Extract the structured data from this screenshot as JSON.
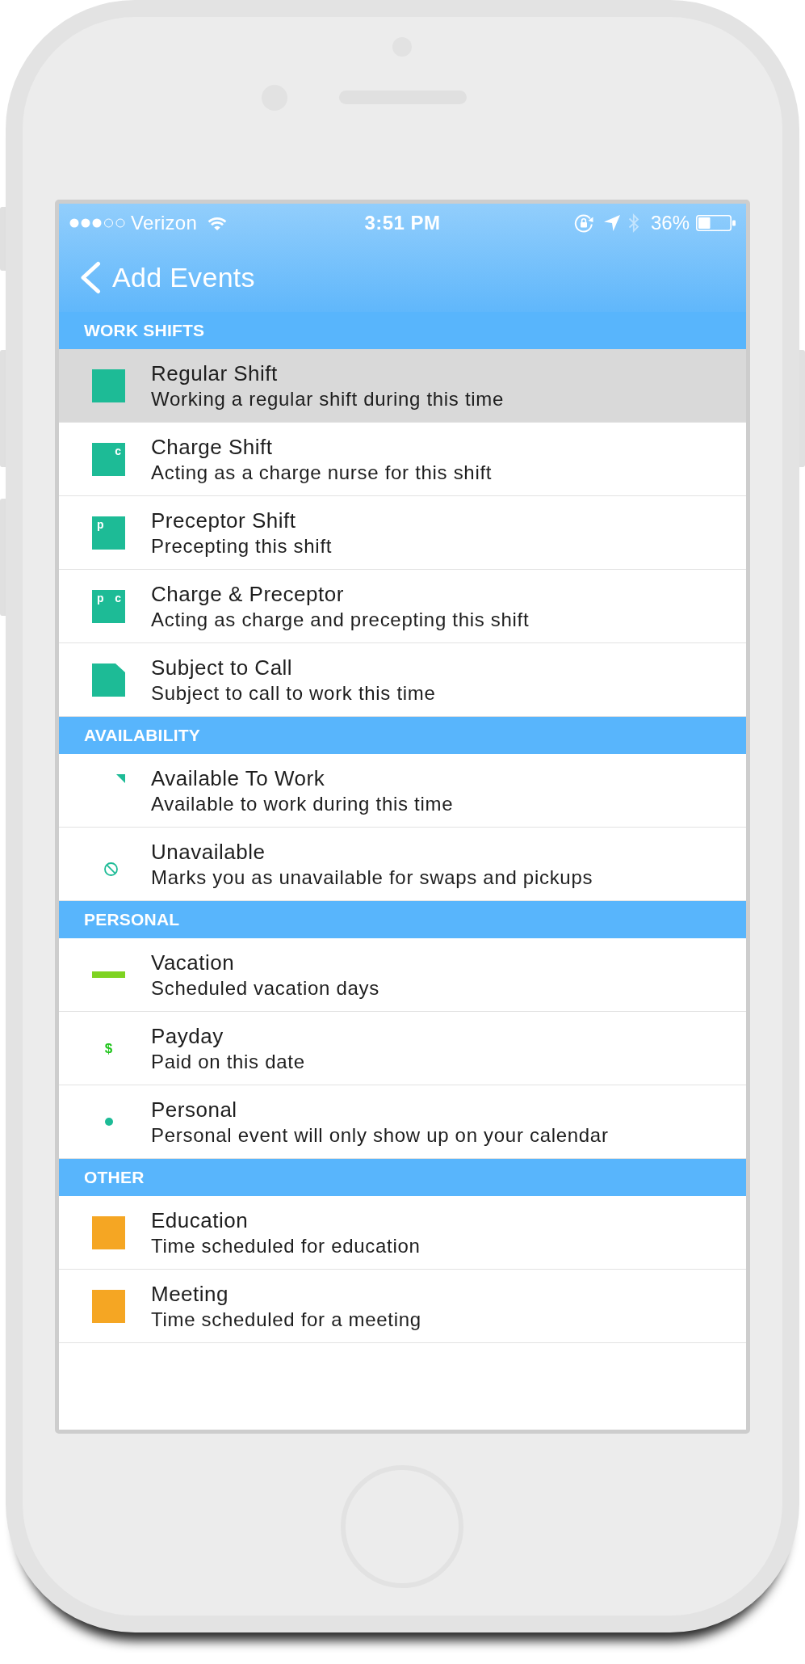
{
  "status_bar": {
    "carrier": "Verizon",
    "time": "3:51 PM",
    "battery": "36%"
  },
  "nav_bar": {
    "back_label": "Add Events"
  },
  "sections": [
    {
      "title": "WORK SHIFTS",
      "items": [
        {
          "title": "Regular Shift",
          "subtitle": "Working a regular shift during this time",
          "kind": "square",
          "color": "#1dbb96",
          "selected": true
        },
        {
          "title": "Charge Shift",
          "subtitle": "Acting as a charge nurse for this shift",
          "kind": "square",
          "letter_right": "c",
          "color": "#1dbb96",
          "selected": false
        },
        {
          "title": "Preceptor Shift",
          "subtitle": "Precepting this shift",
          "kind": "square",
          "letter_left": "p",
          "color": "#1dbb96",
          "selected": false
        },
        {
          "title": "Charge & Preceptor",
          "subtitle": "Acting as charge and precepting this shift",
          "kind": "square",
          "letter_left": "p",
          "letter_right": "c",
          "color": "#1dbb96",
          "selected": false
        },
        {
          "title": "Subject to Call",
          "subtitle": "Subject to call to work this time",
          "kind": "folded",
          "color": "#1dbb96",
          "selected": false
        }
      ]
    },
    {
      "title": "AVAILABILITY",
      "items": [
        {
          "title": "Available To Work",
          "subtitle": "Available to work during this time",
          "kind": "corner",
          "color": "#1dbb96",
          "selected": false
        },
        {
          "title": "Unavailable",
          "subtitle": "Marks you as unavailable for swaps and pickups",
          "kind": "blocked",
          "color": "#1dbb96",
          "selected": false
        }
      ]
    },
    {
      "title": "PERSONAL",
      "items": [
        {
          "title": "Vacation",
          "subtitle": "Scheduled vacation days",
          "kind": "bar",
          "color": "#7ed321",
          "selected": false
        },
        {
          "title": "Payday",
          "subtitle": "Paid on this date",
          "kind": "dollar",
          "symbol": "$",
          "color": "#22c51e",
          "selected": false
        },
        {
          "title": "Personal",
          "subtitle": "Personal event will only show up on your calendar",
          "kind": "dot",
          "color": "#1dbb96",
          "selected": false
        }
      ]
    },
    {
      "title": "OTHER",
      "items": [
        {
          "title": "Education",
          "subtitle": "Time scheduled for education",
          "kind": "square",
          "color": "#f5a623",
          "selected": false
        },
        {
          "title": "Meeting",
          "subtitle": "Time scheduled for a meeting",
          "kind": "square",
          "color": "#f5a623",
          "selected": false
        }
      ]
    }
  ]
}
